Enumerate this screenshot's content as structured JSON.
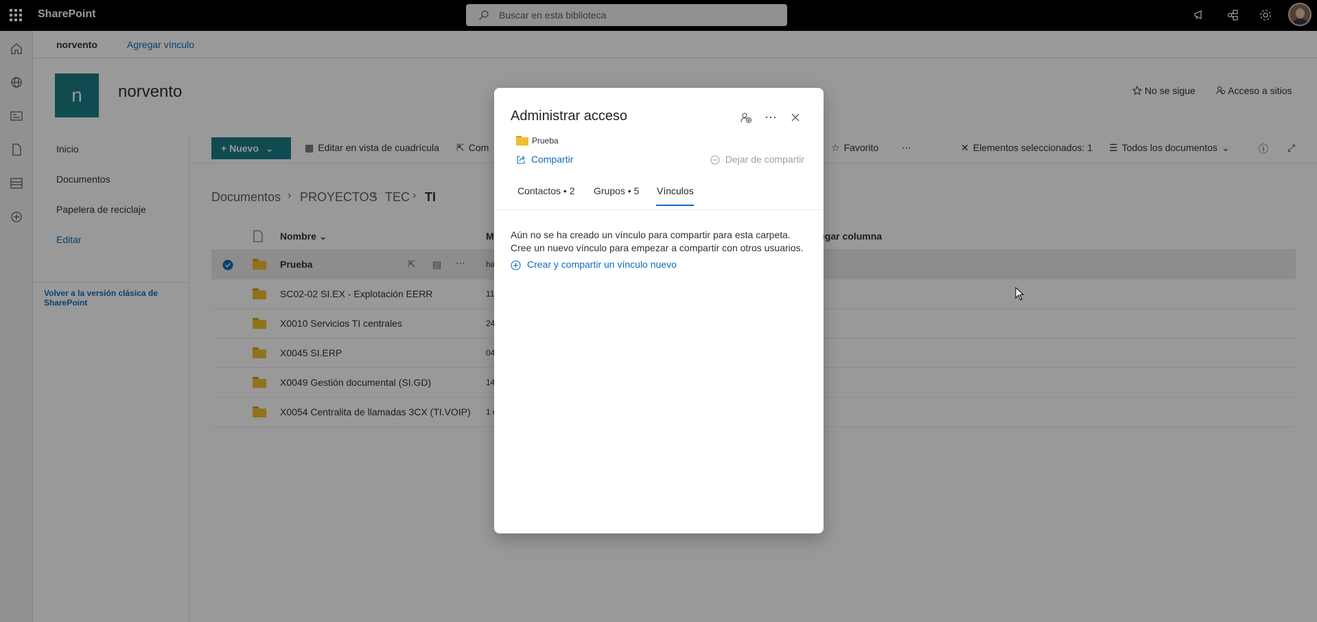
{
  "suitebar": {
    "app_name": "SharePoint",
    "search_placeholder": "Buscar en esta biblioteca",
    "icons": [
      "megaphone-icon",
      "share-network-icon",
      "gear-icon",
      "help-icon",
      "avatar"
    ]
  },
  "hub": {
    "site_link": "norvento",
    "add_link": "Agregar vínculo"
  },
  "site": {
    "logo_letter": "n",
    "title": "norvento",
    "follow": "No se sigue",
    "site_access": "Acceso a sitios"
  },
  "leftnav": {
    "items": [
      "Inicio",
      "Documentos",
      "Papelera de reciclaje"
    ],
    "edit": "Editar",
    "classic_link": "Volver a la versión clásica de SharePoint"
  },
  "commandbar": {
    "new_label": "Nuevo",
    "grid_edit": "Editar en vista de cuadrícula",
    "share_partial": "Com",
    "favorite": "Favorito",
    "selected": "Elementos seleccionados: 1",
    "view": "Todos los documentos"
  },
  "breadcrumb": [
    "Documentos",
    "PROYECTOS",
    "TEC",
    "TI"
  ],
  "list": {
    "header_name": "Nombre",
    "header_modified_partial": "M",
    "header_add_column": "egar columna",
    "rows": [
      {
        "name": "Prueba",
        "modified": "ha"
      },
      {
        "name": "SC02-02 SI.EX - Explotación EERR",
        "modified": "11"
      },
      {
        "name": "X0010 Servicios TI centrales",
        "modified": "24"
      },
      {
        "name": "X0045 SI.ERP",
        "modified": "04"
      },
      {
        "name": "X0049 Gestión documental (SI.GD)",
        "modified": "14"
      },
      {
        "name": "X0054 Centralita de llamadas 3CX (TI.VOIP)",
        "modified": "1 d"
      }
    ]
  },
  "dialog": {
    "title": "Administrar acceso",
    "item_name": "Prueba",
    "share": "Compartir",
    "unshare": "Dejar de compartir",
    "tabs": [
      "Contactos • 2",
      "Grupos • 5",
      "Vínculos"
    ],
    "message_line1": "Aún no se ha creado un vínculo para compartir para esta carpeta.",
    "message_line2": "Cree un nuevo vínculo para empezar a compartir con otros usuarios.",
    "create_link": "Crear y compartir un vínculo nuevo"
  },
  "colors": {
    "accent": "#0f6cbd",
    "theme": "#1b7d87",
    "folder": "#f1be30"
  }
}
